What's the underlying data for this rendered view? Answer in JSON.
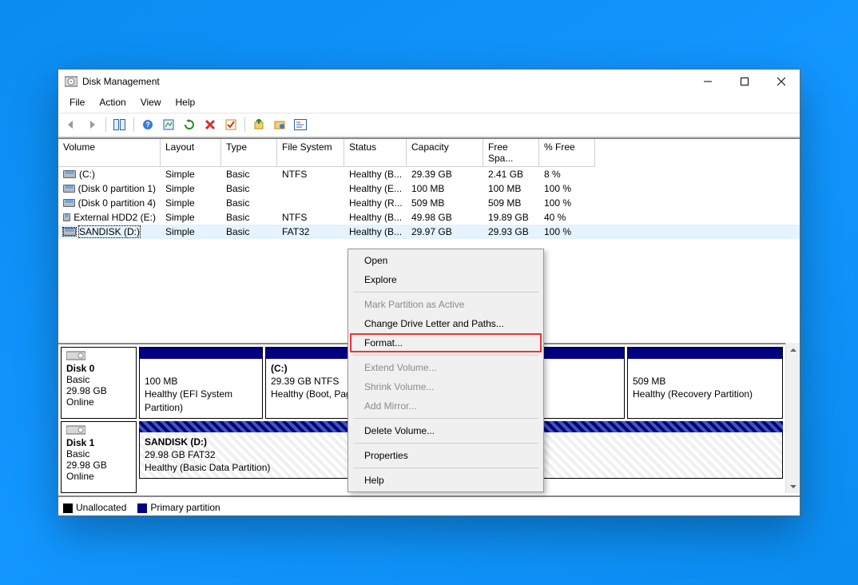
{
  "window": {
    "title": "Disk Management"
  },
  "menu": {
    "file": "File",
    "action": "Action",
    "view": "View",
    "help": "Help"
  },
  "columns": [
    "Volume",
    "Layout",
    "Type",
    "File System",
    "Status",
    "Capacity",
    "Free Spa...",
    "% Free"
  ],
  "rows": [
    {
      "vol": "(C:)",
      "layout": "Simple",
      "type": "Basic",
      "fs": "NTFS",
      "status": "Healthy (B...",
      "cap": "29.39 GB",
      "free": "2.41 GB",
      "pct": "8 %",
      "sel": false
    },
    {
      "vol": "(Disk 0 partition 1)",
      "layout": "Simple",
      "type": "Basic",
      "fs": "",
      "status": "Healthy (E...",
      "cap": "100 MB",
      "free": "100 MB",
      "pct": "100 %",
      "sel": false
    },
    {
      "vol": "(Disk 0 partition 4)",
      "layout": "Simple",
      "type": "Basic",
      "fs": "",
      "status": "Healthy (R...",
      "cap": "509 MB",
      "free": "509 MB",
      "pct": "100 %",
      "sel": false
    },
    {
      "vol": "External HDD2 (E:)",
      "layout": "Simple",
      "type": "Basic",
      "fs": "NTFS",
      "status": "Healthy (B...",
      "cap": "49.98 GB",
      "free": "19.89 GB",
      "pct": "40 %",
      "sel": false
    },
    {
      "vol": "SANDISK (D:)",
      "layout": "Simple",
      "type": "Basic",
      "fs": "FAT32",
      "status": "Healthy (B...",
      "cap": "29.97 GB",
      "free": "29.93 GB",
      "pct": "100 %",
      "sel": true
    }
  ],
  "disk0": {
    "name": "Disk 0",
    "type": "Basic",
    "size": "29.98 GB",
    "status": "Online",
    "p0": {
      "l1": "100 MB",
      "l2": "Healthy (EFI System Partition)"
    },
    "p1": {
      "title": "(C:)",
      "l1": "29.39 GB NTFS",
      "l2": "Healthy (Boot, Page File)"
    },
    "p2": {
      "l1": "509 MB",
      "l2": "Healthy (Recovery Partition)"
    }
  },
  "disk1": {
    "name": "Disk 1",
    "type": "Basic",
    "size": "29.98 GB",
    "status": "Online",
    "p0": {
      "title": "SANDISK  (D:)",
      "l1": "29.98 GB FAT32",
      "l2": "Healthy (Basic Data Partition)"
    }
  },
  "legend": {
    "unalloc": "Unallocated",
    "primary": "Primary partition"
  },
  "ctx": {
    "open": "Open",
    "explore": "Explore",
    "mark": "Mark Partition as Active",
    "chdrv": "Change Drive Letter and Paths...",
    "format": "Format...",
    "extend": "Extend Volume...",
    "shrink": "Shrink Volume...",
    "mirror": "Add Mirror...",
    "delete": "Delete Volume...",
    "props": "Properties",
    "help": "Help"
  }
}
